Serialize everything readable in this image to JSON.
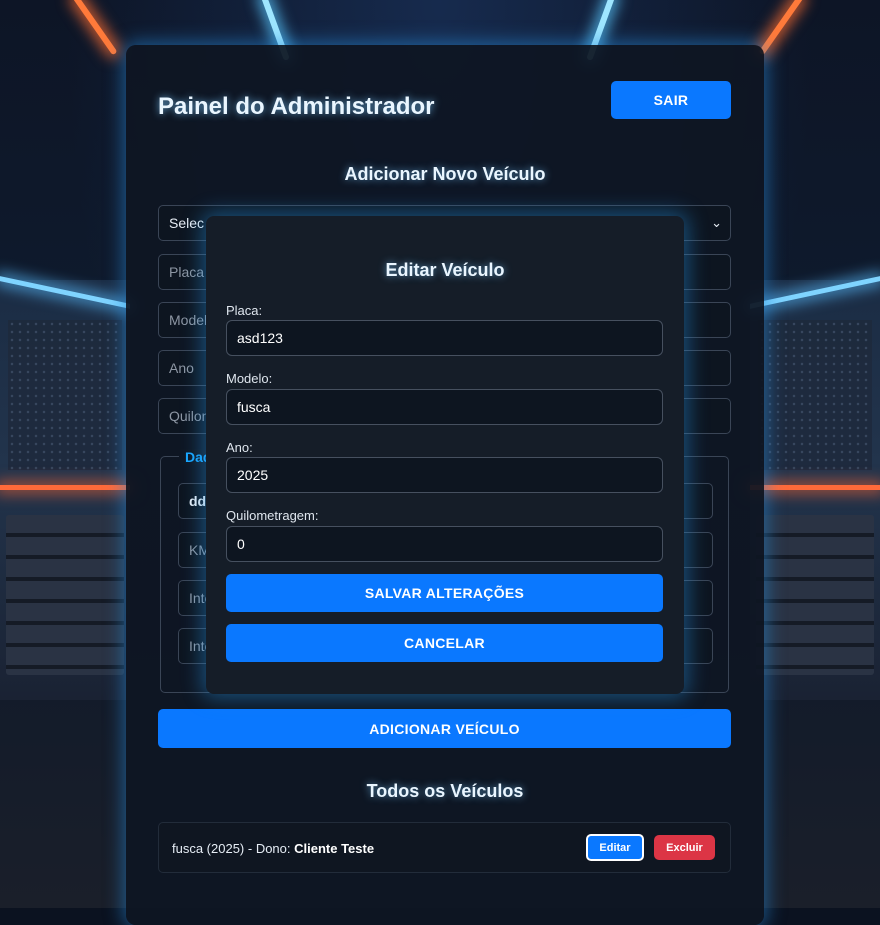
{
  "header": {
    "title": "Painel do Administrador",
    "logout_label": "SAIR"
  },
  "add_form": {
    "title": "Adicionar Novo Veículo",
    "owner_select_value": "Selec",
    "placa_placeholder": "Placa d",
    "modelo_placeholder": "Model",
    "ano_placeholder": "Ano",
    "km_placeholder": "Quilon",
    "fieldset_legend": "Dad",
    "inner_fields": [
      "dd/",
      "KM",
      "Inte",
      "Inte"
    ],
    "submit_label": "ADICIONAR VEÍCULO"
  },
  "vehicles": {
    "title": "Todos os Veículos",
    "items": [
      {
        "description": "fusca (2025) - Dono: ",
        "owner": "Cliente Teste",
        "edit_label": "Editar",
        "delete_label": "Excluir"
      }
    ]
  },
  "edit_modal": {
    "title": "Editar Veículo",
    "placa_label": "Placa:",
    "placa_value": "asd123",
    "modelo_label": "Modelo:",
    "modelo_value": "fusca",
    "ano_label": "Ano:",
    "ano_value": "2025",
    "km_label": "Quilometragem:",
    "km_value": "0",
    "save_label": "SALVAR ALTERAÇÕES",
    "cancel_label": "CANCELAR"
  },
  "colors": {
    "accent": "#0a78ff",
    "danger": "#dc3545",
    "legend": "#19a7ff"
  }
}
